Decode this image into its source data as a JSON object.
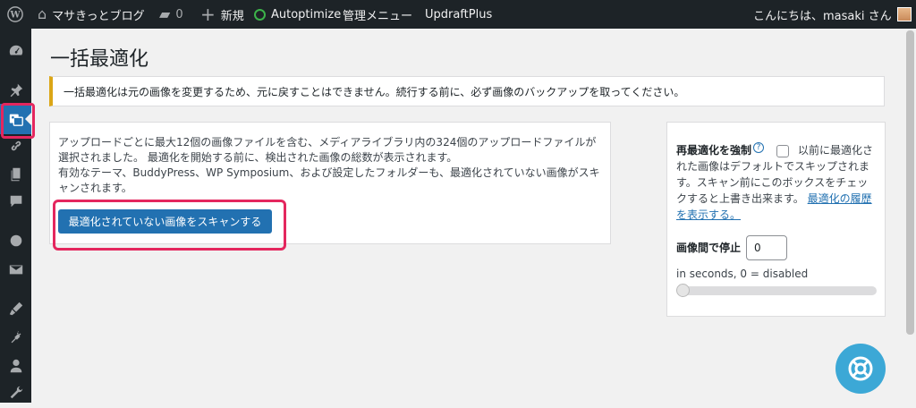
{
  "adminbar": {
    "site_name": "マサきっとブログ",
    "comments_count": "0",
    "new_label": "新規",
    "autoptimize_label": "Autoptimize",
    "admin_menu_label": "管理メニュー",
    "updraft_label": "UpdraftPlus",
    "greeting": "こんにちは、masaki さん"
  },
  "sidebar": {
    "items": [
      "dashboard-icon",
      "pin-icon",
      "ewww-image-icon",
      "link-icon",
      "pages-icon",
      "comments-icon",
      "circle-icon",
      "mail-icon",
      "appearance-icon",
      "plugins-icon",
      "users-icon",
      "tools-icon"
    ],
    "active_index": 2
  },
  "page": {
    "title": "一括最適化",
    "notice": "一括最適化は元の画像を変更するため、元に戻すことはできません。続行する前に、必ず画像のバックアップを取ってください。"
  },
  "scan": {
    "line1": "アップロードごとに最大12個の画像ファイルを含む、メディアライブラリ内の324個のアップロードファイルが選択されました。 最適化を開始する前に、検出された画像の総数が表示されます。",
    "line2": "有効なテーマ、BuddyPress、WP Symposium、および設定したフォルダーも、最適化されていない画像がスキャンされます。",
    "button": "最適化されていない画像をスキャンする"
  },
  "options": {
    "force_label": "再最適化を強制",
    "force_help": "?",
    "force_desc": "以前に最適化された画像はデフォルトでスキップされます。スキャン前にこのボックスをチェックすると上書き出来ます。",
    "history_link": "最適化の履歴を表示する。",
    "pause_label": "画像間で停止",
    "pause_value": "0",
    "pause_unit": "in seconds, 0 = disabled",
    "slider_value": 0
  },
  "colors": {
    "accent": "#2271b1",
    "highlight": "#e4275e",
    "notice_border": "#dba617"
  }
}
